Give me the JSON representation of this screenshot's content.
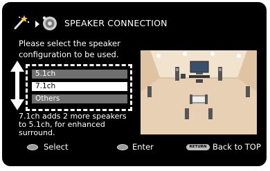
{
  "header": {
    "title": "SPEAKER CONNECTION",
    "wand_icon": "magic-wand-icon",
    "speaker_icon": "speaker-setup-icon"
  },
  "instruction": {
    "line1": "Please select the speaker",
    "line2": "configuration to be used."
  },
  "options": [
    {
      "label": "5.1ch",
      "selected": false
    },
    {
      "label": "7.1ch",
      "selected": true
    },
    {
      "label": "Others",
      "selected": false
    }
  ],
  "description": {
    "line1": "7.1ch adds 2 more speakers",
    "line2": "to 5.1ch, for enhanced",
    "line3": "surround."
  },
  "footer": {
    "select_label": "Select",
    "enter_label": "Enter",
    "return_button_text": "RETURN",
    "back_label": "Back to TOP"
  },
  "colors": {
    "background": "#000000",
    "selected_option": "#ffffff",
    "unselected_option": "#6f6f6f",
    "room_floor": "#e8d0b4",
    "room_wall": "#f2e3cf"
  }
}
